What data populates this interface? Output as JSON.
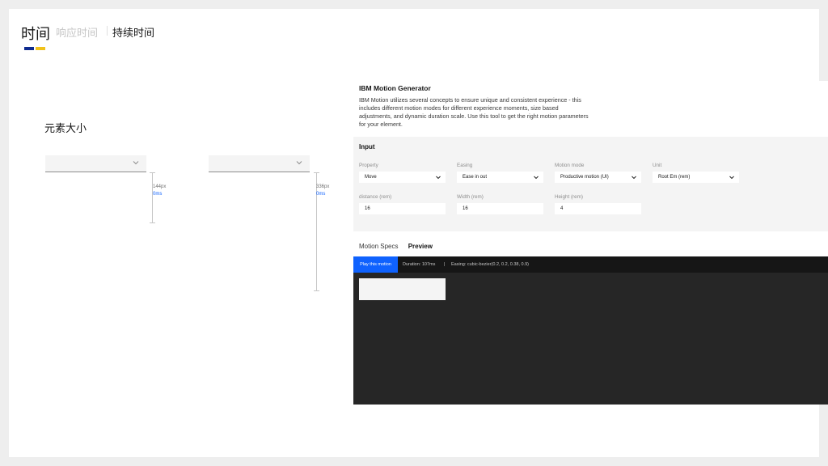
{
  "header": {
    "title": "时间",
    "tabs": [
      {
        "label": "响应时间",
        "active": false
      },
      {
        "label": "持续时间",
        "active": true
      }
    ]
  },
  "section_label": "元素大小",
  "demos": [
    {
      "measure_px": "144px",
      "measure_ms": "0ms"
    },
    {
      "measure_px": "336px",
      "measure_ms": "0ms"
    }
  ],
  "panel": {
    "title": "IBM Motion Generator",
    "description": "IBM Motion utilizes several concepts to ensure unique and consistent experience - this includes different motion modes for different experience moments, size based adjustments, and dynamic duration scale. Use this tool to get the right motion parameters for your element.",
    "input": {
      "title": "Input",
      "property": {
        "label": "Property",
        "value": "Move"
      },
      "easing": {
        "label": "Easing",
        "value": "Ease in out"
      },
      "motion_mode": {
        "label": "Motion mode",
        "value": "Productive motion (UI)"
      },
      "unit": {
        "label": "Unit",
        "value": "Root Em (rem)"
      },
      "distance": {
        "label": "distance (rem)",
        "value": "16"
      },
      "width": {
        "label": "Width (rem)",
        "value": "16"
      },
      "height": {
        "label": "Height (rem)",
        "value": "4"
      }
    },
    "tabs": {
      "specs": "Motion Specs",
      "preview": "Preview"
    },
    "preview": {
      "play_label": "Play this motion",
      "duration": "Duration: 107ms",
      "separator": "|",
      "easing": "Easing: cubic-bezier(0.2, 0.2, 0.38, 0.9)"
    }
  },
  "colors": {
    "accent_blue": "#0f62fe",
    "brand_navy": "#0f2b8f",
    "brand_yellow": "#f1c21b",
    "dark_bg": "#262626"
  }
}
